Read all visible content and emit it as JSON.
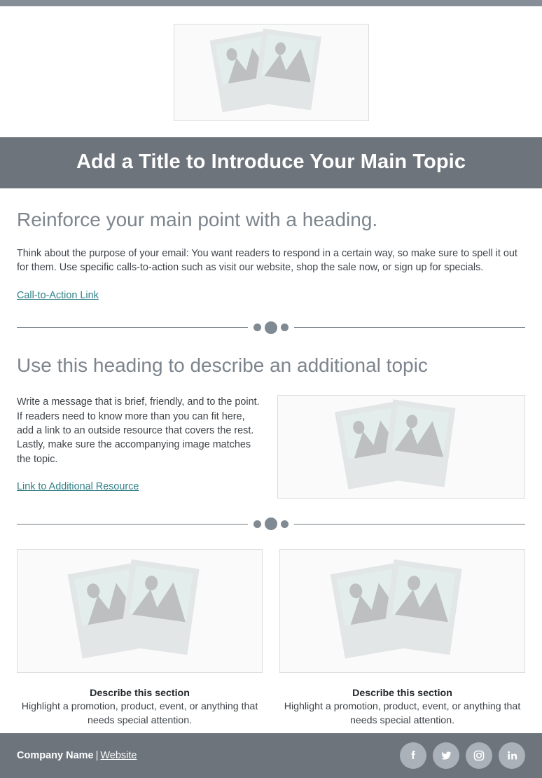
{
  "top_bar": {
    "color": "#868f97"
  },
  "hero": {
    "image_placeholder": "photo-placeholder"
  },
  "title_banner": {
    "background": "#6d747c",
    "title": "Add a Title to Introduce Your Main Topic"
  },
  "section_one": {
    "heading": "Reinforce your main point with a heading.",
    "body": "Think about the purpose of your email: You want readers to respond in a certain way, so make sure to spell it out for them. Use specific calls-to-action such as visit our website, shop the sale now, or sign up for specials.",
    "link_label": "Call-to-Action Link",
    "link_color": "#2f8086"
  },
  "divider": {
    "dot_color": "#808a92",
    "line_color": "#6f777f"
  },
  "section_two": {
    "heading": "Use this heading to describe an additional topic",
    "body": "Write a message that is brief, friendly, and to the point. If readers need to know more than you can fit here, add a link to an outside resource that covers the rest. Lastly, make sure the accompanying image matches the topic.",
    "link_label": "Link to Additional Resource",
    "image_placeholder": "photo-placeholder"
  },
  "cards": [
    {
      "image_placeholder": "photo-placeholder",
      "title": "Describe this section",
      "description": "Highlight a promotion, product, event, or anything that needs special attention."
    },
    {
      "image_placeholder": "photo-placeholder",
      "title": "Describe this section",
      "description": "Highlight a promotion, product, event, or anything that needs special attention."
    }
  ],
  "footer": {
    "background": "#6d747c",
    "company": "Company Name",
    "separator": "|",
    "website_label": "Website",
    "socials": [
      {
        "name": "facebook-icon",
        "glyph": "f"
      },
      {
        "name": "twitter-icon",
        "glyph": "t"
      },
      {
        "name": "instagram-icon",
        "glyph": "i"
      },
      {
        "name": "linkedin-icon",
        "glyph": "in"
      }
    ]
  }
}
